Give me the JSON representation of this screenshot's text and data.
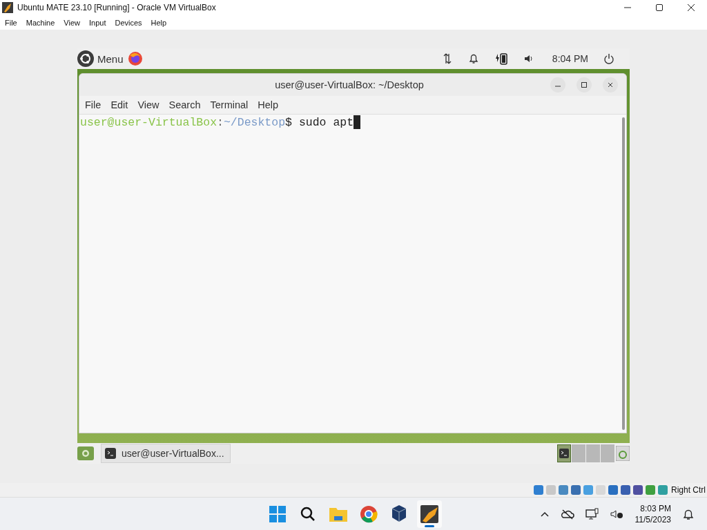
{
  "host_window": {
    "title": "Ubuntu MATE 23.10 [Running] - Oracle VM VirtualBox",
    "menu": [
      "File",
      "Machine",
      "View",
      "Input",
      "Devices",
      "Help"
    ]
  },
  "guest": {
    "top_panel": {
      "menu_label": "Menu",
      "clock": "8:04 PM"
    },
    "terminal": {
      "title": "user@user-VirtualBox: ~/Desktop",
      "menu": [
        "File",
        "Edit",
        "View",
        "Search",
        "Terminal",
        "Help"
      ],
      "prompt": {
        "user_host": "user@user-VirtualBox",
        "separator": ":",
        "path": "~/Desktop",
        "symbol": "$",
        "command": "sudo apt"
      }
    },
    "bottom_panel": {
      "task": "user@user-VirtualBox...",
      "workspaces": [
        {
          "selected": true
        },
        {
          "selected": false
        },
        {
          "selected": false
        },
        {
          "selected": false
        }
      ]
    }
  },
  "status_bar": {
    "host_key": "Right Ctrl"
  },
  "taskbar": {
    "apps": [
      {
        "kind": "start",
        "selected": false
      },
      {
        "kind": "search",
        "selected": false
      },
      {
        "kind": "files",
        "selected": false
      },
      {
        "kind": "browser",
        "selected": false
      },
      {
        "kind": "vbox",
        "selected": false
      },
      {
        "kind": "vm",
        "selected": true
      }
    ],
    "time": "8:03 PM",
    "date": "11/5/2023"
  }
}
